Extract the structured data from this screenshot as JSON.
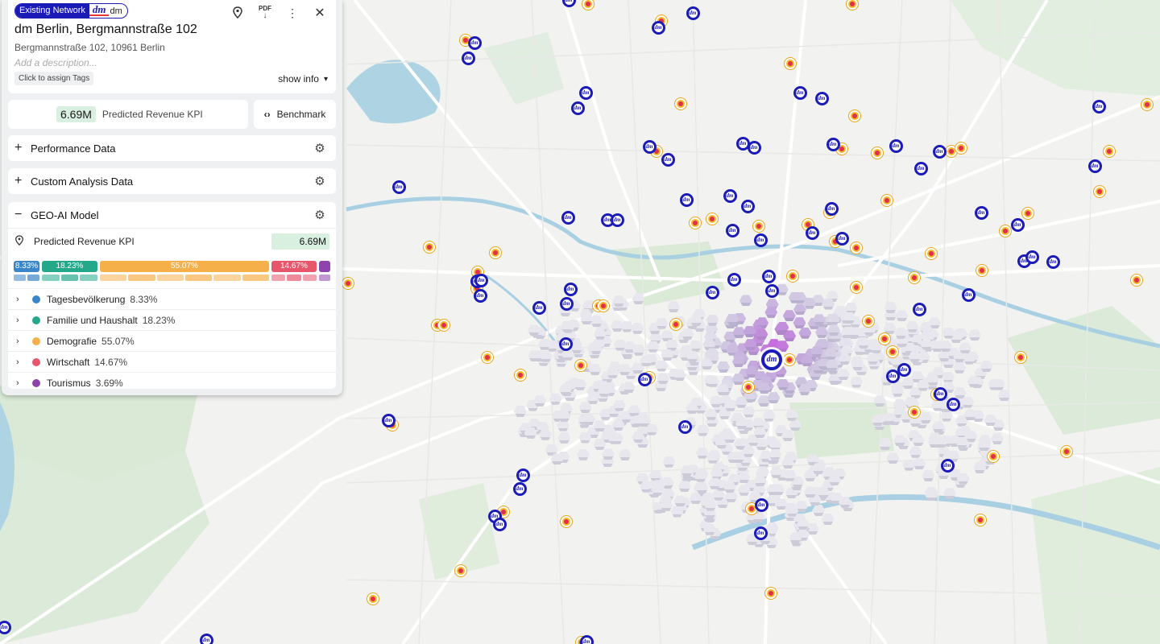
{
  "panel": {
    "badge": {
      "network_label": "Existing Network",
      "logo_text": "dm",
      "brand_name": "dm"
    },
    "header_icons": [
      {
        "name": "location-pin-icon"
      },
      {
        "name": "pdf-download-icon",
        "label": "PDF"
      },
      {
        "name": "more-vertical-icon"
      },
      {
        "name": "close-icon"
      }
    ],
    "title": "dm Berlin, Bergmannstraße 102",
    "address": "Bergmannstraße 102, 10961 Berlin",
    "description_placeholder": "Add a description...",
    "tags_label": "Click to assign Tags",
    "show_info_label": "show info",
    "kpi": {
      "value": "6.69M",
      "label": "Predicted Revenue KPI"
    },
    "benchmark_label": "Benchmark",
    "sections": [
      {
        "label": "Performance Data",
        "expanded": false
      },
      {
        "label": "Custom Analysis Data",
        "expanded": false
      },
      {
        "label": "GEO-AI Model",
        "expanded": true
      }
    ],
    "geo_ai": {
      "kpi_label": "Predicted Revenue KPI",
      "kpi_value": "6.69M",
      "segments": [
        {
          "label": "8.33%",
          "share": 0.0833,
          "color": "#3a86c8"
        },
        {
          "label": "18.23%",
          "share": 0.1823,
          "color": "#23a98a"
        },
        {
          "label": "55.07%",
          "share": 0.5507,
          "color": "#f5b04a"
        },
        {
          "label": "14.67%",
          "share": 0.1467,
          "color": "#e8566c"
        },
        {
          "label": "",
          "share": 0.0369,
          "color": "#8e44ad"
        }
      ],
      "categories": [
        {
          "name": "Tagesbevölkerung",
          "pct": "8.33%",
          "color": "#3a86c8"
        },
        {
          "name": "Familie und Haushalt",
          "pct": "18.23%",
          "color": "#23a98a"
        },
        {
          "name": "Demografie",
          "pct": "55.07%",
          "color": "#f5b04a"
        },
        {
          "name": "Wirtschaft",
          "pct": "14.67%",
          "color": "#e8566c"
        },
        {
          "name": "Tourismus",
          "pct": "3.69%",
          "color": "#8e44ad"
        }
      ]
    }
  },
  "map": {
    "store_marker_text": "dm"
  }
}
